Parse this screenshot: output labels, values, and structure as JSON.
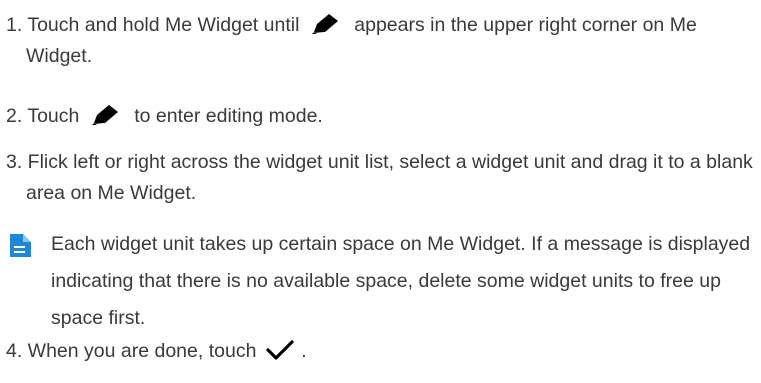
{
  "steps": {
    "s1_part1": "1. Touch and hold Me Widget until",
    "s1_part2": "appears in the upper right corner on Me Widget.",
    "s2_part1": "2. Touch",
    "s2_part2": "to enter editing mode.",
    "s3": "3. Flick left or right across the widget unit list, select a widget unit and drag it to a blank area on Me Widget.",
    "s4_part1": "4. When you are done, touch",
    "s4_part2": "."
  },
  "note": {
    "text": "Each widget unit takes up certain space on Me Widget. If a message is displayed indicating that there is no available space, delete some widget units to free up space first."
  },
  "icons": {
    "edit": "pencil-icon",
    "confirm": "checkmark-icon",
    "note": "note-document-icon"
  },
  "colors": {
    "text": "#3a3a3a",
    "note_icon": "#1e88d8"
  }
}
